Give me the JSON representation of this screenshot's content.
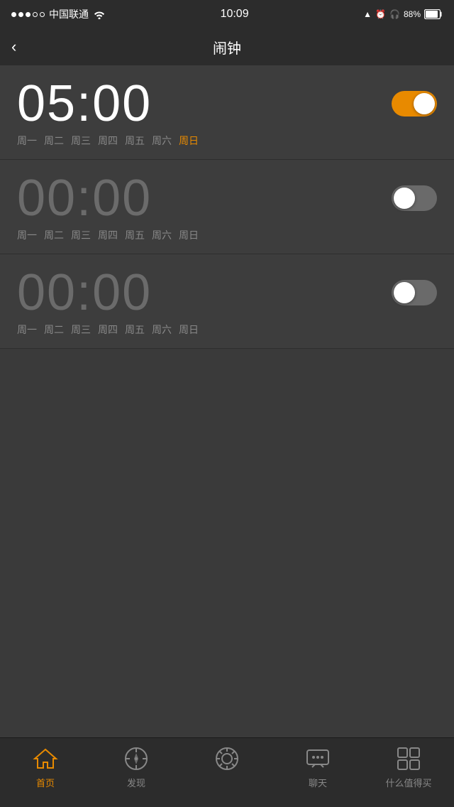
{
  "statusBar": {
    "carrier": "中国联通",
    "time": "10:09",
    "battery": "88%"
  },
  "navBar": {
    "title": "闹钟",
    "backLabel": "<"
  },
  "alarms": [
    {
      "id": 1,
      "time": "05:00",
      "active": true,
      "days": [
        {
          "label": "周一",
          "highlight": false
        },
        {
          "label": "周二",
          "highlight": false
        },
        {
          "label": "周三",
          "highlight": false
        },
        {
          "label": "周四",
          "highlight": false
        },
        {
          "label": "周五",
          "highlight": false
        },
        {
          "label": "周六",
          "highlight": false
        },
        {
          "label": "周日",
          "highlight": true
        }
      ]
    },
    {
      "id": 2,
      "time": "00:00",
      "active": false,
      "days": [
        {
          "label": "周一",
          "highlight": false
        },
        {
          "label": "周二",
          "highlight": false
        },
        {
          "label": "周三",
          "highlight": false
        },
        {
          "label": "周四",
          "highlight": false
        },
        {
          "label": "周五",
          "highlight": false
        },
        {
          "label": "周六",
          "highlight": false
        },
        {
          "label": "周日",
          "highlight": false
        }
      ]
    },
    {
      "id": 3,
      "time": "00:00",
      "active": false,
      "days": [
        {
          "label": "周一",
          "highlight": false
        },
        {
          "label": "周二",
          "highlight": false
        },
        {
          "label": "周三",
          "highlight": false
        },
        {
          "label": "周四",
          "highlight": false
        },
        {
          "label": "周五",
          "highlight": false
        },
        {
          "label": "周六",
          "highlight": false
        },
        {
          "label": "周日",
          "highlight": false
        }
      ]
    }
  ],
  "tabBar": {
    "items": [
      {
        "label": "首页",
        "active": true
      },
      {
        "label": "发现",
        "active": false
      },
      {
        "label": "",
        "active": false
      },
      {
        "label": "聊天",
        "active": false
      },
      {
        "label": "什么值得买",
        "active": false
      }
    ]
  }
}
